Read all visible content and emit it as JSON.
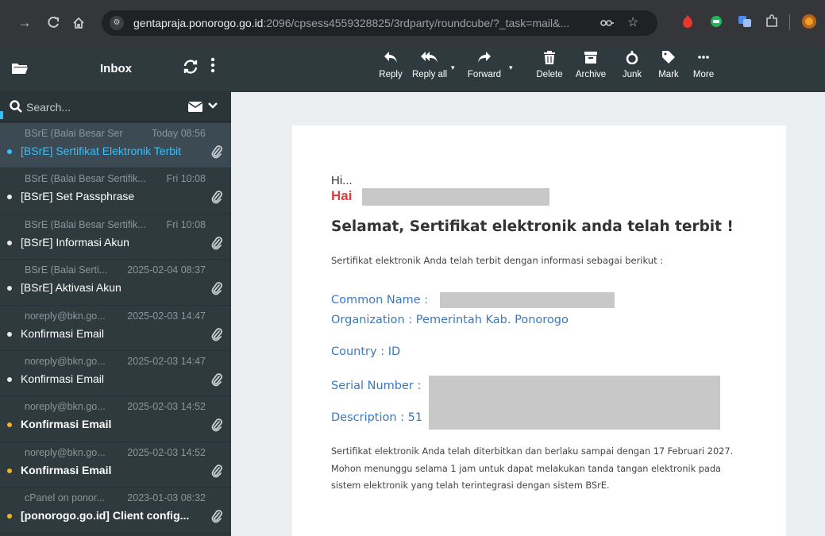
{
  "browser": {
    "url_host": "gentapraja.ponorogo.go.id",
    "url_path": ":2096/cpsess4559328825/3rdparty/roundcube/?_task=mail&..."
  },
  "sidebar": {
    "folder_title": "Inbox",
    "search_placeholder": "Search..."
  },
  "messages": [
    {
      "from": "BSrE (Balai Besar Ser...",
      "date": "Today 08:56",
      "subject": "[BSrE] Sertifikat Elektronik Terbit",
      "selected": true,
      "unread": false
    },
    {
      "from": "BSrE (Balai Besar Sertifik...",
      "date": "Fri 10:08",
      "subject": "[BSrE] Set Passphrase",
      "selected": false,
      "unread": false
    },
    {
      "from": "BSrE (Balai Besar Sertifik...",
      "date": "Fri 10:08",
      "subject": "[BSrE] Informasi Akun",
      "selected": false,
      "unread": false
    },
    {
      "from": "BSrE (Balai Serti...",
      "date": "2025-02-04 08:37",
      "subject": "[BSrE] Aktivasi Akun",
      "selected": false,
      "unread": false
    },
    {
      "from": "noreply@bkn.go...",
      "date": "2025-02-03 14:47",
      "subject": "Konfirmasi Email",
      "selected": false,
      "unread": false
    },
    {
      "from": "noreply@bkn.go...",
      "date": "2025-02-03 14:47",
      "subject": "Konfirmasi Email",
      "selected": false,
      "unread": false
    },
    {
      "from": "noreply@bkn.go...",
      "date": "2025-02-03 14:52",
      "subject": "Konfirmasi Email",
      "selected": false,
      "unread": true
    },
    {
      "from": "noreply@bkn.go...",
      "date": "2025-02-03 14:52",
      "subject": "Konfirmasi Email",
      "selected": false,
      "unread": true
    },
    {
      "from": "cPanel on ponor...",
      "date": "2023-01-03 08:32",
      "subject": "[ponorogo.go.id] Client config...",
      "selected": false,
      "unread": true
    }
  ],
  "toolbar": {
    "reply": "Reply",
    "reply_all": "Reply all",
    "forward": "Forward",
    "delete": "Delete",
    "archive": "Archive",
    "junk": "Junk",
    "mark": "Mark",
    "more": "More"
  },
  "mail": {
    "greeting_hi": "Hi...",
    "greeting_hai": "Hai",
    "heading": "Selamat, Sertifikat elektronik anda telah terbit !",
    "intro": "Sertifikat elektronik Anda telah terbit dengan informasi sebagai berikut :",
    "common_name": "Common Name :",
    "organization": "Organization : Pemerintah Kab. Ponorogo",
    "country": "Country : ID",
    "serial_number": "Serial Number :",
    "description": "Description : 51",
    "footer": "Sertifikat elektronik Anda telah diterbitkan dan berlaku sampai dengan 17 Februari 2027. Mohon menunggu selama 1 jam untuk dapat melakukan tanda tangan elektronik pada sistem elektronik yang telah terintegrasi dengan sistem BSrE."
  },
  "colors": {
    "sidebar_bg": "#2f3a3f",
    "selected_blue": "#37beff",
    "unread_dot": "#f0b323",
    "hai_red": "#d93d3d",
    "field_blue": "#3d79bb"
  }
}
